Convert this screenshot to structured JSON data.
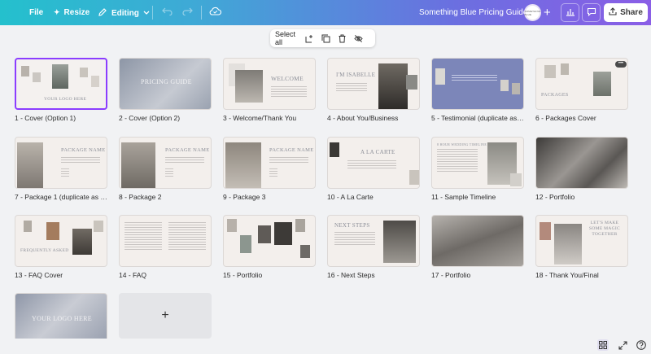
{
  "topbar": {
    "file": "File",
    "resize": "Resize",
    "editing": "Editing",
    "doc_title": "Something Blue Pricing Guide",
    "share": "Share",
    "avatar_text": "SOMETHING BLUE"
  },
  "selection_toolbar": {
    "select_all": "Select all"
  },
  "pages": [
    {
      "label": "1 - Cover (Option 1)",
      "title": "YOUR LOGO HERE"
    },
    {
      "label": "2 - Cover (Option 2)",
      "title": "PRICING GUIDE"
    },
    {
      "label": "3 - Welcome/Thank You",
      "title": "WELCOME"
    },
    {
      "label": "4 - About You/Business",
      "title": "I'M ISABELLE"
    },
    {
      "label": "5 - Testimonial (duplicate as ...",
      "title": ""
    },
    {
      "label": "6 - Packages Cover",
      "title": "PACKAGES"
    },
    {
      "label": "7 - Package 1 (duplicate as n...",
      "title": "PACKAGE NAME"
    },
    {
      "label": "8 - Package 2",
      "title": "PACKAGE NAME"
    },
    {
      "label": "9 - Package 3",
      "title": "PACKAGE NAME"
    },
    {
      "label": "10 - A La Carte",
      "title": "A LA CARTE"
    },
    {
      "label": "11 - Sample Timeline",
      "title": "8 HOUR WEDDING TIMELINE"
    },
    {
      "label": "12 - Portfolio",
      "title": ""
    },
    {
      "label": "13 - FAQ Cover",
      "title": "FREQUENTLY ASKED"
    },
    {
      "label": "14 - FAQ",
      "title": ""
    },
    {
      "label": "15 - Portfolio",
      "title": ""
    },
    {
      "label": "16 - Next Steps",
      "title": "NEXT STEPS"
    },
    {
      "label": "17 - Portfolio",
      "title": ""
    },
    {
      "label": "18 - Thank You/Final",
      "title": "LET'S MAKE SOME MAGIC TOGETHER"
    },
    {
      "label": "",
      "title": "YOUR LOGO HERE"
    }
  ],
  "add_page": "+",
  "colors": {
    "accent": "#8b3dff",
    "slate_blue": "#7c86b9"
  }
}
